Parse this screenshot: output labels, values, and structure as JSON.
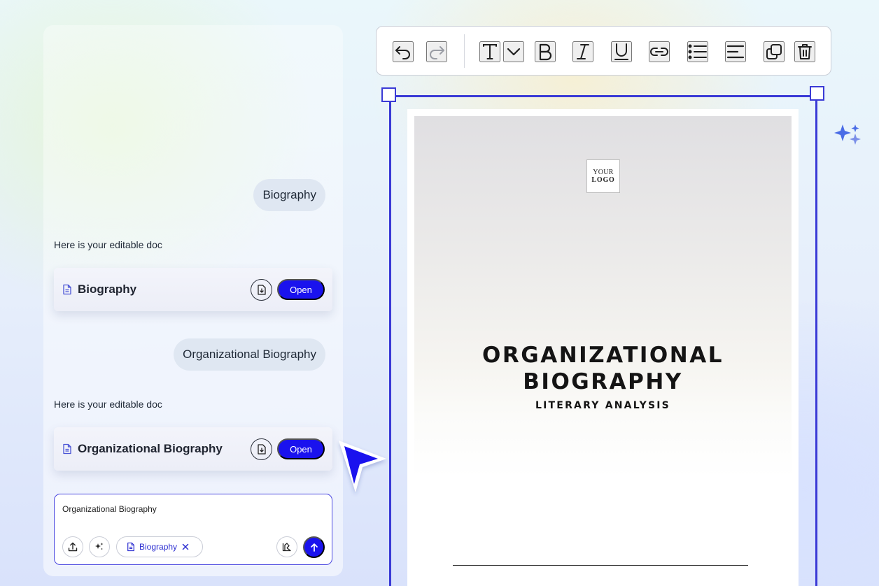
{
  "chat": {
    "messages": [
      {
        "role": "user",
        "text": "Biography"
      },
      {
        "role": "assistant",
        "text": "Here is your editable doc"
      },
      {
        "role": "user",
        "text": "Organizational Biography"
      },
      {
        "role": "assistant",
        "text": "Here is your editable doc"
      }
    ],
    "documents": [
      {
        "title": "Biography",
        "open_label": "Open",
        "icons": [
          "file-icon",
          "download-icon"
        ]
      },
      {
        "title": "Organizational Biography",
        "open_label": "Open",
        "icons": [
          "file-icon",
          "download-icon"
        ]
      }
    ],
    "composer": {
      "value": "Organizational Biography",
      "chip_label": "Biography",
      "icons": [
        "upload-icon",
        "sparkle-icon",
        "file-icon",
        "close-icon",
        "template-icon",
        "arrow-up-icon"
      ]
    }
  },
  "toolbar": {
    "icons": [
      "undo-icon",
      "redo-icon",
      "text-icon",
      "chevron-down-icon",
      "bold-icon",
      "italic-icon",
      "underline-icon",
      "link-icon",
      "bullet-list-icon",
      "align-left-icon",
      "duplicate-icon",
      "trash-icon"
    ]
  },
  "document": {
    "logo_line1": "YOUR",
    "logo_line2": "LOGO",
    "title": "ORGANIZATIONAL\nBIOGRAPHY",
    "subtitle": "LITERARY ANALYSIS"
  },
  "colors": {
    "accent": "#1a12ee",
    "selection": "#3a3ad6",
    "bubble": "#dfe7f2"
  }
}
